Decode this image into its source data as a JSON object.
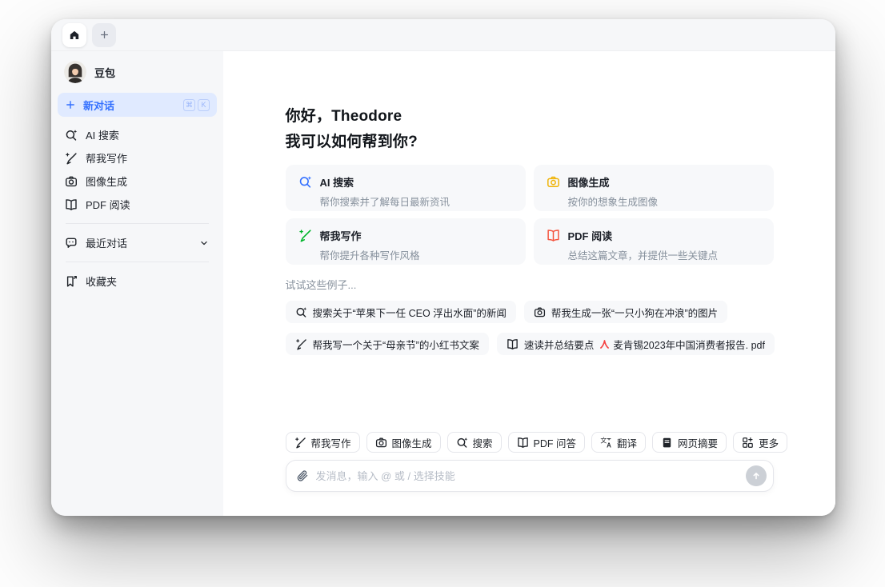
{
  "app": {
    "window_title": "豆包"
  },
  "tabbar": {
    "tabs": [
      {
        "name": "home",
        "icon": "home-icon",
        "active": true
      },
      {
        "name": "new-tab",
        "icon": "plus-icon",
        "active": false
      }
    ]
  },
  "sidebar": {
    "profile_name": "豆包",
    "new_chat": {
      "label": "新对话",
      "icon": "plus-icon",
      "shortcut": [
        "⌘",
        "K"
      ]
    },
    "items": [
      {
        "label": "AI 搜索",
        "icon": "search-sparkle-icon"
      },
      {
        "label": "帮我写作",
        "icon": "pen-sparkle-icon"
      },
      {
        "label": "图像生成",
        "icon": "camera-icon"
      },
      {
        "label": "PDF 阅读",
        "icon": "book-icon"
      }
    ],
    "recent": {
      "label": "最近对话",
      "icon": "chat-bubble-icon",
      "chevron": "chevron-down-icon"
    },
    "favorites": {
      "label": "收藏夹",
      "icon": "bookmark-add-icon"
    }
  },
  "main": {
    "greeting": {
      "line1": "你好，Theodore",
      "line2": "我可以如何帮到你?"
    },
    "feature_cards": [
      {
        "title": "AI 搜索",
        "description": "帮你搜索并了解每日最新资讯",
        "icon": "search-sparkle-icon",
        "icon_color": "#3370FF"
      },
      {
        "title": "图像生成",
        "description": "按你的想象生成图像",
        "icon": "camera-icon",
        "icon_color": "#EFB306"
      },
      {
        "title": "帮我写作",
        "description": "帮你提升各种写作风格",
        "icon": "pen-sparkle-icon",
        "icon_color": "#00B42A"
      },
      {
        "title": "PDF 阅读",
        "description": "总结这篇文章，并提供一些关键点",
        "icon": "book-icon",
        "icon_color": "#F5533D"
      }
    ],
    "examples": {
      "label": "试试这些例子...",
      "chips": [
        {
          "text": "搜索关于“苹果下一任 CEO 浮出水面”的新闻",
          "icon": "search-sparkle-icon"
        },
        {
          "text": "帮我生成一张“一只小狗在冲浪”的图片",
          "icon": "camera-icon"
        },
        {
          "text": "帮我写一个关于“母亲节”的小红书文案",
          "icon": "pen-sparkle-icon"
        },
        {
          "text": "速读并总结要点",
          "icon": "book-icon",
          "attachment": {
            "name": "麦肯锡2023年中国消费者报告. pdf",
            "icon": "pdf-file-icon"
          }
        }
      ]
    },
    "skills": [
      {
        "label": "帮我写作",
        "icon": "pen-sparkle-icon"
      },
      {
        "label": "图像生成",
        "icon": "camera-icon"
      },
      {
        "label": "搜索",
        "icon": "search-sparkle-icon"
      },
      {
        "label": "PDF 问答",
        "icon": "book-icon"
      },
      {
        "label": "翻译",
        "icon": "translate-icon"
      },
      {
        "label": "网页摘要",
        "icon": "webpage-icon"
      },
      {
        "label": "更多",
        "icon": "more-grid-icon"
      }
    ],
    "composer": {
      "placeholder": "发消息，输入 @ 或 / 选择技能",
      "attach_icon": "paperclip-icon",
      "send_icon": "send-arrow-icon"
    }
  },
  "colors": {
    "accent_blue": "#3370FF",
    "new_chat_bg": "#E0EAFF",
    "sidebar_bg": "#F6F7F9",
    "card_bg": "#F7F8FA",
    "border": "#E5E6EB",
    "text_primary": "#1D2129",
    "text_secondary": "#86909C",
    "send_button_bg": "#CCD0D6",
    "pdf_red": "#F53F3F",
    "writing_green": "#00B42A",
    "image_yellow": "#EFB306"
  }
}
